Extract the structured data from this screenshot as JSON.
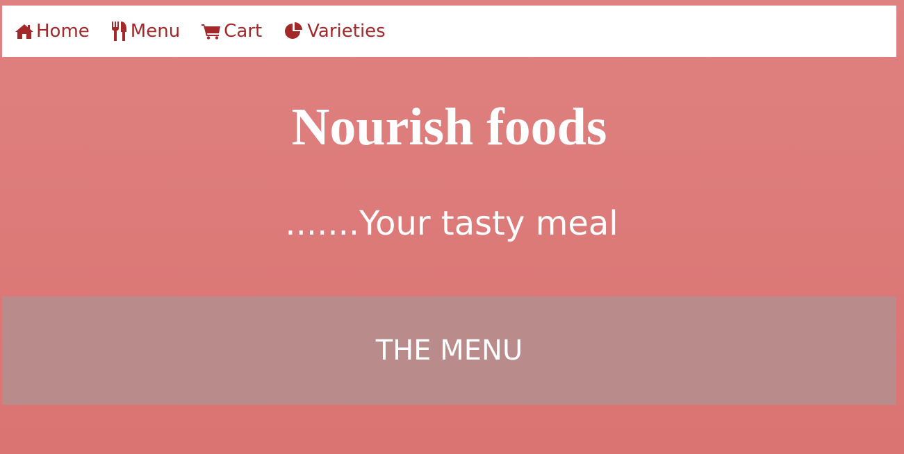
{
  "nav": {
    "items": [
      {
        "label": "Home",
        "icon": "home-icon"
      },
      {
        "label": "Menu",
        "icon": "cutlery-icon"
      },
      {
        "label": "Cart",
        "icon": "cart-icon"
      },
      {
        "label": "Varieties",
        "icon": "pie-chart-icon"
      }
    ]
  },
  "hero": {
    "title": "Nourish foods",
    "tagline": ".......Your tasty meal"
  },
  "section": {
    "menu_heading": "THE MENU"
  },
  "colors": {
    "background": "#dc7c7a",
    "nav_background": "#ffffff",
    "nav_text": "#a3282a",
    "banner": "#b98c8b",
    "hero_text": "#ffffff"
  }
}
